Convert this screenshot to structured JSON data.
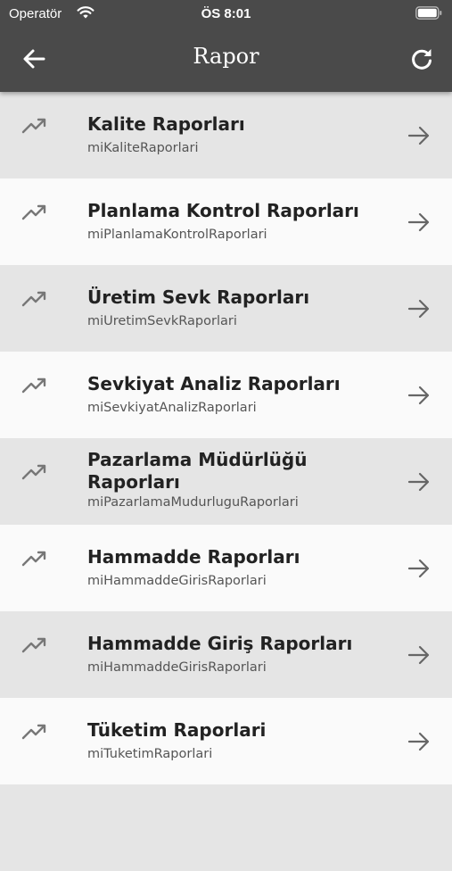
{
  "status_bar": {
    "carrier": "Operatör",
    "time": "ÖS 8:01"
  },
  "app_bar": {
    "title": "Rapor",
    "back_icon": "arrow-left-icon",
    "refresh_icon": "refresh-icon"
  },
  "items": [
    {
      "title": "Kalite Raporları",
      "subtitle": "miKaliteRaporlari"
    },
    {
      "title": "Planlama Kontrol Raporları",
      "subtitle": "miPlanlamaKontrolRaporlari"
    },
    {
      "title": "Üretim Sevk Raporları",
      "subtitle": "miUretimSevkRaporlari"
    },
    {
      "title": "Sevkiyat Analiz Raporları",
      "subtitle": "miSevkiyatAnalizRaporlari"
    },
    {
      "title": "Pazarlama Müdürlüğü Raporları",
      "subtitle": "miPazarlamaMudurluguRaporlari"
    },
    {
      "title": "Hammadde Raporları",
      "subtitle": "miHammaddeGirisRaporlari"
    },
    {
      "title": "Hammadde Giriş Raporları",
      "subtitle": "miHammaddeGirisRaporlari"
    },
    {
      "title": "Tüketim Raporlari",
      "subtitle": "miTuketimRaporlari"
    }
  ],
  "colors": {
    "app_bar": "#4a4a4a",
    "row_shaded": "#e5e5e5",
    "row_plain": "#fafafa"
  }
}
